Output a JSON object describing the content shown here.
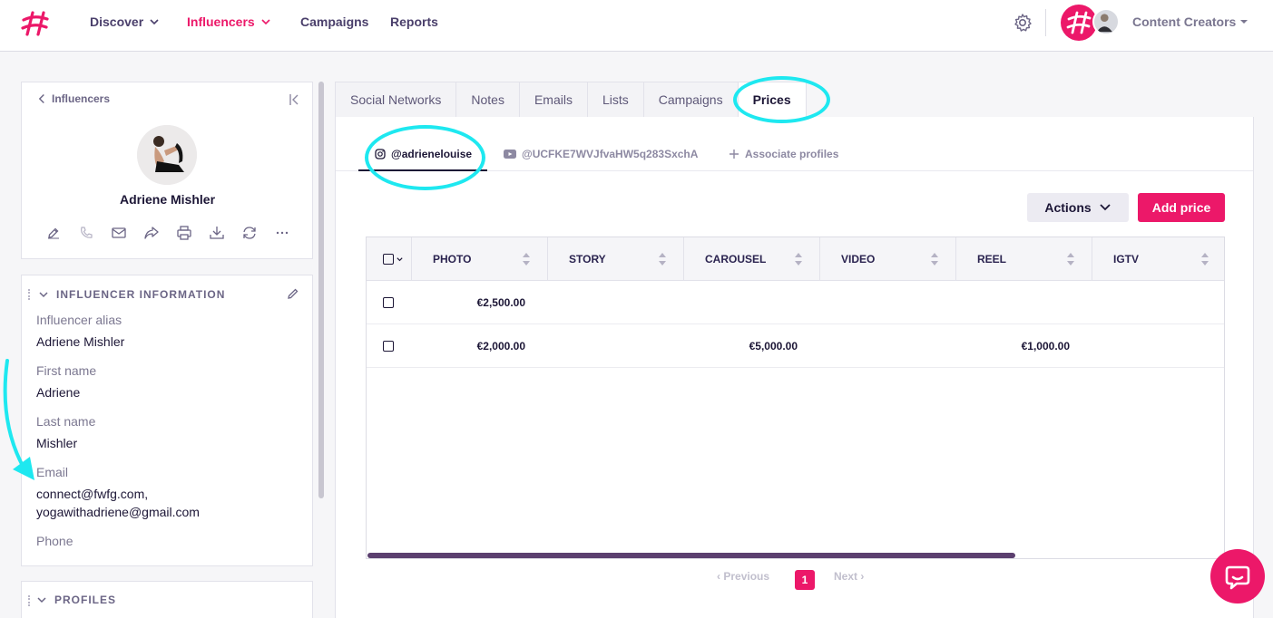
{
  "nav": {
    "discover": "Discover",
    "influencers": "Influencers",
    "campaigns": "Campaigns",
    "reports": "Reports",
    "account": "Content Creators"
  },
  "icons": {
    "logo": "hashtag-logo-icon",
    "settings": "gear-icon",
    "chevron": "chevron-down-icon"
  },
  "profile": {
    "back_label": "Influencers",
    "name": "Adriene Mishler",
    "actions": [
      "edit-icon",
      "phone-icon",
      "mail-icon",
      "share-icon",
      "print-icon",
      "download-icon",
      "refresh-icon",
      "more-icon"
    ]
  },
  "info": {
    "title": "INFLUENCER INFORMATION",
    "alias_label": "Influencer alias",
    "alias_value": "Adriene Mishler",
    "first_label": "First name",
    "first_value": "Adriene",
    "last_label": "Last name",
    "last_value": "Mishler",
    "email_label": "Email",
    "email_value_1": "connect@fwfg.com,",
    "email_value_2": "yogawithadriene@gmail.com",
    "phone_label": "Phone"
  },
  "profiles_section": {
    "title": "PROFILES"
  },
  "tabs": [
    "Social Networks",
    "Notes",
    "Emails",
    "Lists",
    "Campaigns",
    "Prices"
  ],
  "active_tab": "Prices",
  "subtabs": {
    "instagram": "@adrienelouise",
    "youtube": "@UCFKE7WVJfvaHW5q283SxchA",
    "associate": "Associate profiles"
  },
  "buttons": {
    "actions": "Actions",
    "add_price": "Add price"
  },
  "table": {
    "columns": [
      "PHOTO",
      "STORY",
      "CAROUSEL",
      "VIDEO",
      "REEL",
      "IGTV"
    ],
    "rows": [
      {
        "photo": "€2,500.00",
        "story": "",
        "carousel": "",
        "video": "",
        "reel": "",
        "igtv": ""
      },
      {
        "photo": "€2,000.00",
        "story": "",
        "carousel": "€5,000.00",
        "video": "",
        "reel": "€1,000.00",
        "igtv": ""
      }
    ]
  },
  "pagination": {
    "previous": "Previous",
    "page": "1",
    "next": "Next"
  },
  "colors": {
    "brand": "#ec1869",
    "highlight": "#1ee8f0",
    "text_dark": "#1c1636"
  }
}
